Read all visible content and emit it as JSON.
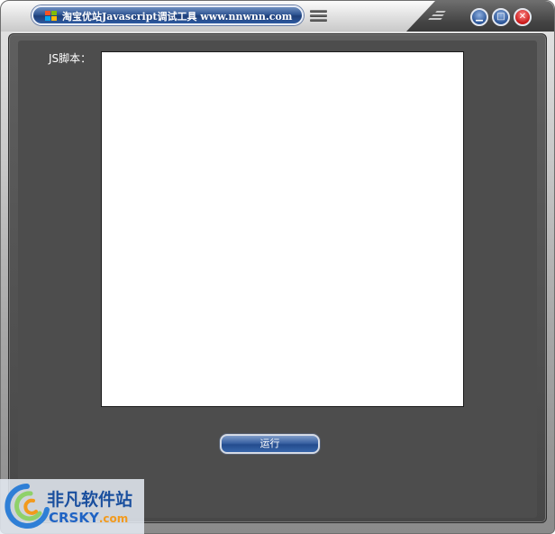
{
  "window": {
    "title": "淘宝优站Javascript调试工具 www.nnwnn.com"
  },
  "titlebar": {
    "app_icon": "windows-flag-icon",
    "menu_icon": "menu-icon",
    "buttons": {
      "minimize_icon": "minimize-icon",
      "maximize_icon": "maximize-icon",
      "close_icon": "close-icon"
    }
  },
  "form": {
    "script_label": "JS脚本：",
    "script_value": "",
    "run_label": "运行"
  },
  "watermark": {
    "brand_cn": "非凡软件站",
    "brand_en": "CRSKY",
    "brand_suffix": ".com"
  },
  "colors": {
    "client_bg": "#4d4d4d",
    "button_blue": "#2f5694",
    "close_red": "#c91818"
  }
}
